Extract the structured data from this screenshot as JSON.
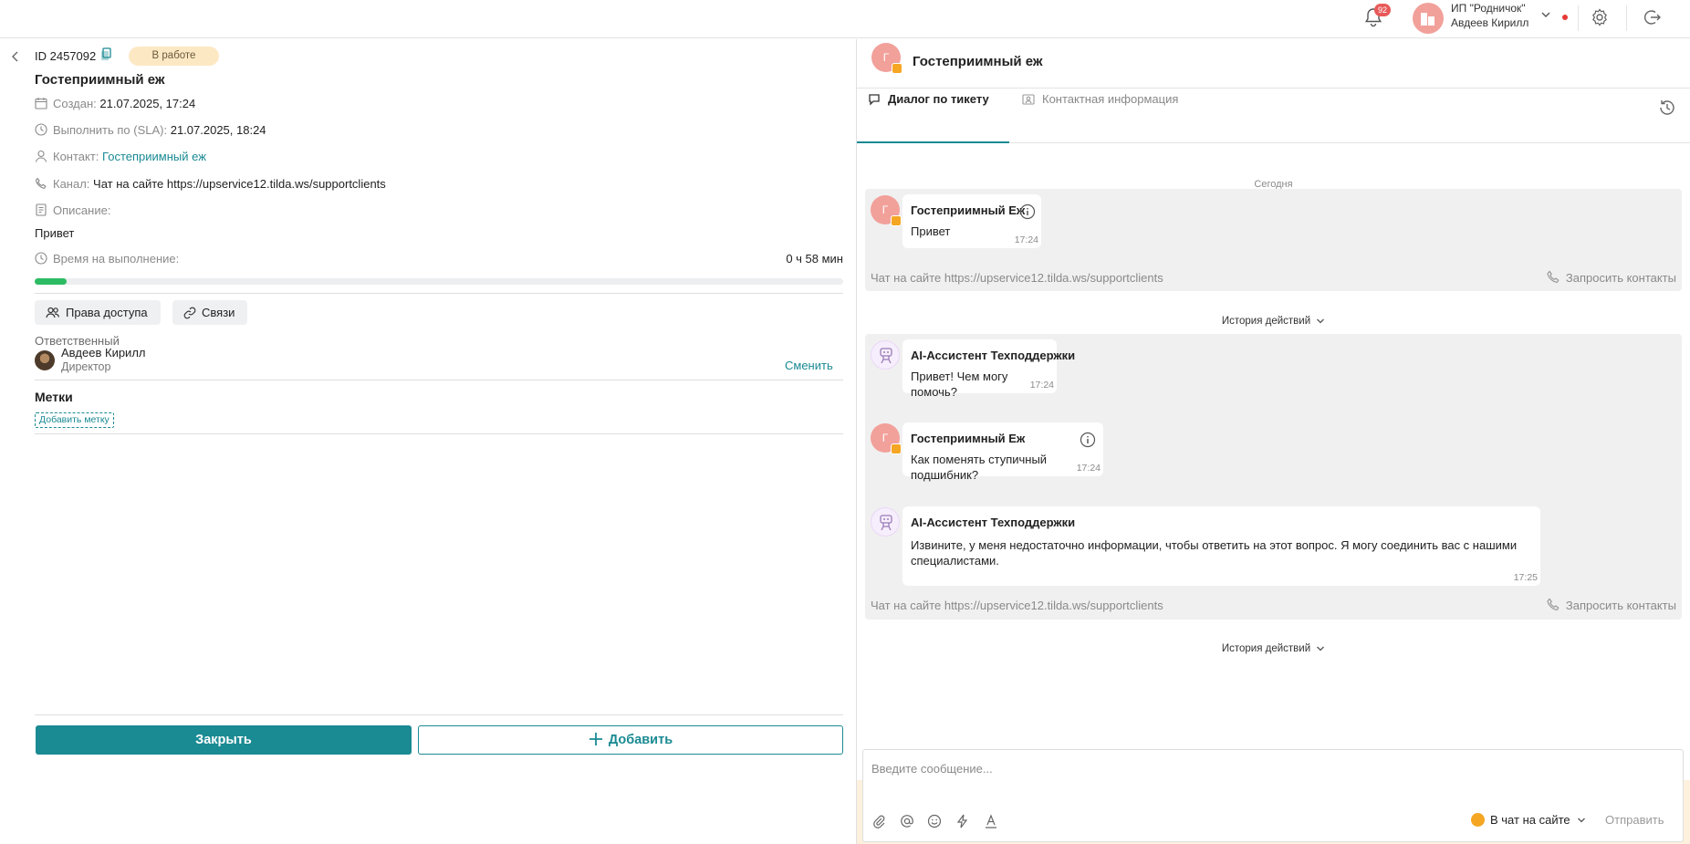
{
  "topbar": {
    "notifications_count": "92",
    "company": "ИП \"Родничок\"",
    "user": "Авдеев Кирилл"
  },
  "ticket": {
    "id": "ID 2457092",
    "status": "В работе",
    "title": "Гостеприимный еж",
    "created_label": "Создан:",
    "created_value": "21.07.2025, 17:24",
    "sla_label": "Выполнить по (SLA):",
    "sla_value": "21.07.2025, 18:24",
    "contact_label": "Контакт:",
    "contact_value": "Гостеприимный еж",
    "channel_label": "Канал:",
    "channel_value": "Чат на сайте https://upservice12.tilda.ws/supportclients",
    "description_label": "Описание:",
    "description_value": "Привет",
    "time_label": "Время на выполнение:",
    "time_value": "0 ч 58 мин",
    "time_progress": 0.04,
    "access_label": "Права доступа",
    "links_label": "Связи",
    "responsible_label": "Ответственный",
    "responsible_name": "Авдеев Кирилл",
    "responsible_role": "Директор",
    "change_label": "Сменить",
    "tags_title": "Метки",
    "add_tag_label": "Добавить метку",
    "close_label": "Закрыть",
    "add_label": "Добавить"
  },
  "chat": {
    "header_name": "Гостеприимный еж",
    "avatar_letter": "Г",
    "tab_dialog": "Диалог по тикету",
    "tab_contact": "Контактная информация",
    "date_separator": "Сегодня",
    "messages": [
      {
        "sender": "Гостеприимный Еж",
        "text": "Привет",
        "time": "17:24"
      },
      {
        "sender": "AI-Ассистент Техподдержки",
        "text": "Привет! Чем могу помочь?",
        "time": "17:24"
      },
      {
        "sender": "Гостеприимный Еж",
        "text": "Как поменять ступичный подшибник?",
        "time": "17:24"
      },
      {
        "sender": "AI-Ассистент Техподдержки",
        "text": "Извините, у меня недостаточно информации, чтобы ответить на этот вопрос. Я могу соединить вас с нашими специалистами.",
        "time": "17:25"
      }
    ],
    "channel_footer": "Чат на сайте https://upservice12.tilda.ws/supportclients",
    "request_contacts": "Запросить контакты",
    "history_label": "История действий",
    "compose_placeholder": "Введите сообщение...",
    "channel_select": "В чат на сайте",
    "send_label": "Отправить"
  },
  "colors": {
    "accent": "#1a8a93",
    "progress": "#2dbb63",
    "status_bg": "#fde8c4",
    "avatar": "#f2a09a"
  }
}
